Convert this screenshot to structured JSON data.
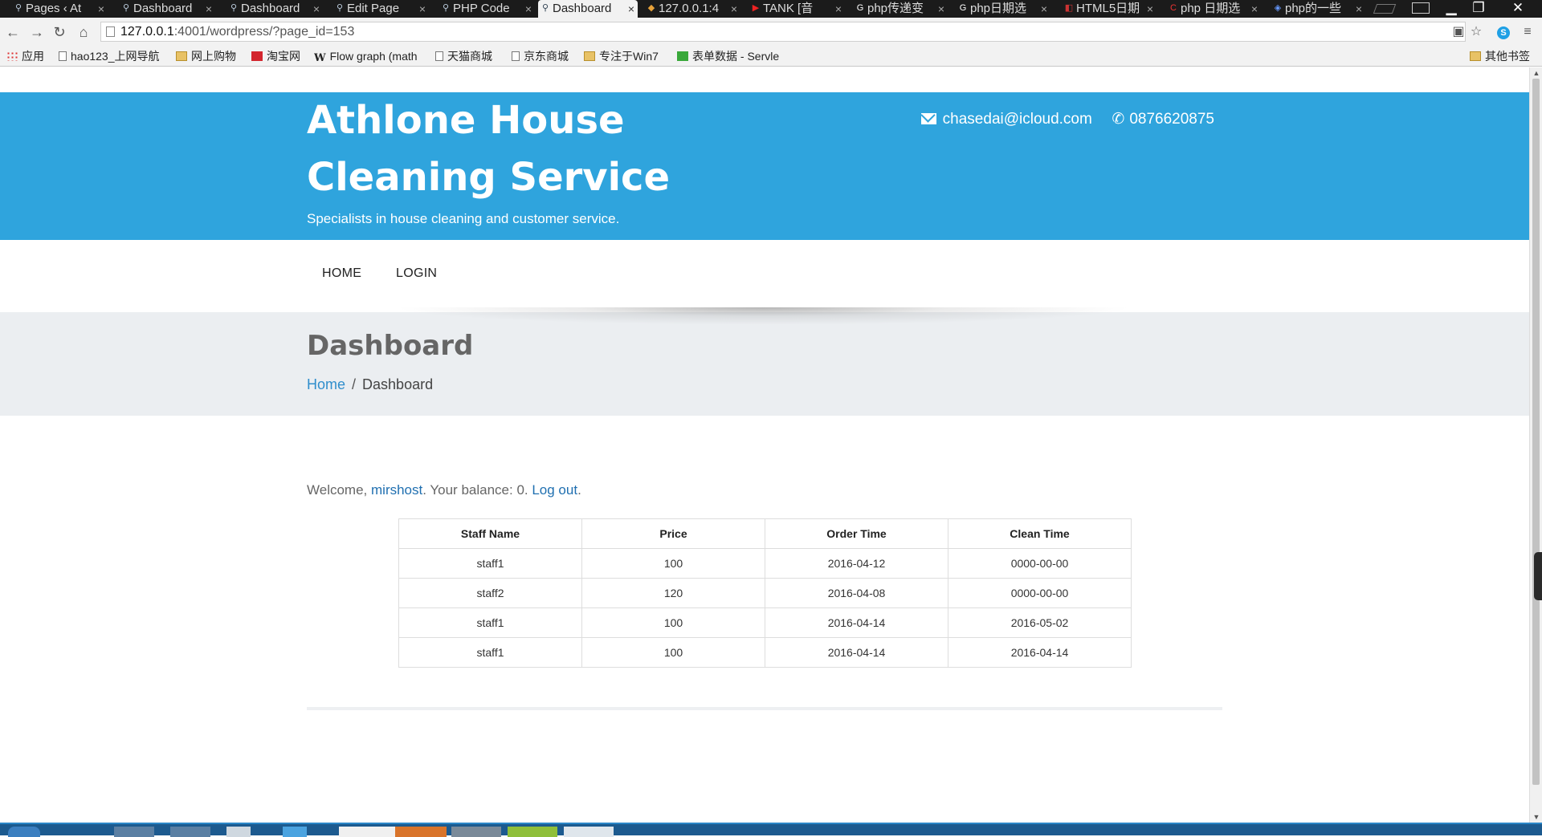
{
  "browser": {
    "tabs": [
      {
        "label": "Pages ‹ At"
      },
      {
        "label": "Dashboard"
      },
      {
        "label": "Dashboard"
      },
      {
        "label": "Edit Page"
      },
      {
        "label": "PHP Code"
      },
      {
        "label": "Dashboard",
        "active": true
      },
      {
        "label": "127.0.0.1:4"
      },
      {
        "label": "TANK [音"
      },
      {
        "label": "php传递变"
      },
      {
        "label": "php日期选"
      },
      {
        "label": "HTML5日期"
      },
      {
        "label": "php 日期选"
      },
      {
        "label": "php的一些"
      }
    ],
    "url_host": "127.0.0.1",
    "url_rest": ":4001/wordpress/?page_id=153",
    "bookmarks": [
      {
        "label": "应用",
        "icon": "apps-grid-icon"
      },
      {
        "label": "hao123_上网导航",
        "icon": "page-icon"
      },
      {
        "label": "网上购物",
        "icon": "folder-icon"
      },
      {
        "label": "淘宝网",
        "icon": "taobao-icon"
      },
      {
        "label": "Flow graph (math",
        "icon": "wikipedia-icon"
      },
      {
        "label": "天猫商城",
        "icon": "page-icon"
      },
      {
        "label": "京东商城",
        "icon": "page-icon"
      },
      {
        "label": "专注于Win7",
        "icon": "folder-icon"
      },
      {
        "label": "表单数据 - Servle",
        "icon": "forms-icon"
      }
    ],
    "other_bookmarks": "其他书签"
  },
  "site": {
    "title_line1": "Athlone House",
    "title_line2": "Cleaning Service",
    "tagline": "Specialists in house cleaning and customer service.",
    "email": "chasedai@icloud.com",
    "phone": "0876620875",
    "brand_color": "#2fa4dd"
  },
  "nav": {
    "home": "HOME",
    "login": "LOGIN"
  },
  "page": {
    "title": "Dashboard",
    "breadcrumb_home": "Home",
    "breadcrumb_sep": "/",
    "breadcrumb_current": "Dashboard"
  },
  "welcome": {
    "prefix": "Welcome, ",
    "username": "mirshost",
    "middle": ". Your balance: 0. ",
    "logout": "Log out",
    "suffix": "."
  },
  "orders": {
    "headers": [
      "Staff Name",
      "Price",
      "Order Time",
      "Clean Time"
    ],
    "rows": [
      [
        "staff1",
        "100",
        "2016-04-12",
        "0000-00-00"
      ],
      [
        "staff2",
        "120",
        "2016-04-08",
        "0000-00-00"
      ],
      [
        "staff1",
        "100",
        "2016-04-14",
        "2016-05-02"
      ],
      [
        "staff1",
        "100",
        "2016-04-14",
        "2016-04-14"
      ]
    ]
  }
}
